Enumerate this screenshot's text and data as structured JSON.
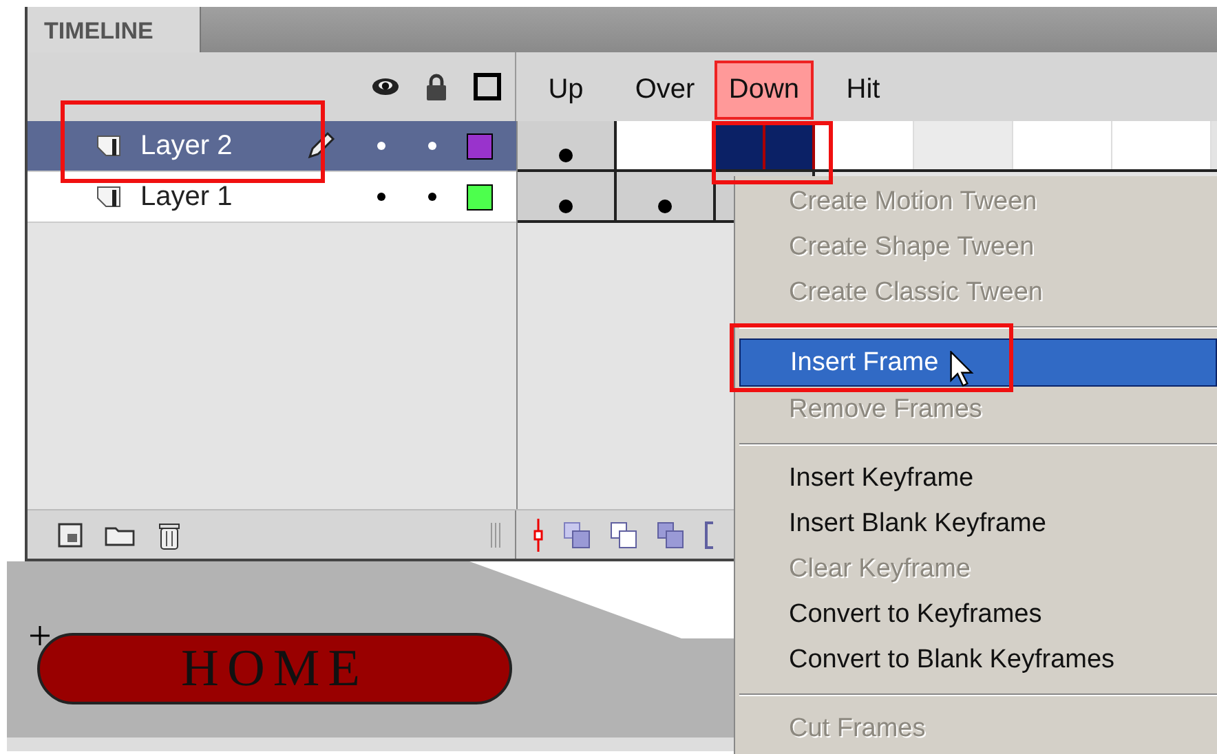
{
  "panel": {
    "tab": "TIMELINE"
  },
  "frame_labels": [
    {
      "label": "Up",
      "selected": false
    },
    {
      "label": "Over",
      "selected": false
    },
    {
      "label": "Down",
      "selected": true
    },
    {
      "label": "Hit",
      "selected": false
    }
  ],
  "layers": [
    {
      "name": "Layer 2",
      "selected": true,
      "editing": true,
      "color": "#9933cc",
      "frames": [
        {
          "kind": "keyframe"
        },
        {
          "kind": "empty"
        },
        {
          "kind": "selected"
        },
        {
          "kind": "selected"
        },
        {
          "kind": "empty"
        },
        {
          "kind": "shaded"
        },
        {
          "kind": "empty"
        },
        {
          "kind": "empty"
        }
      ]
    },
    {
      "name": "Layer 1",
      "selected": false,
      "editing": false,
      "color": "#4dff4d",
      "frames": [
        {
          "kind": "keyframe"
        },
        {
          "kind": "keyframe"
        },
        {
          "kind": "frame"
        }
      ]
    }
  ],
  "stage": {
    "button_label": "HOME"
  },
  "context_menu": [
    {
      "kind": "item",
      "label": "Create Motion Tween",
      "disabled": true,
      "selected": false
    },
    {
      "kind": "item",
      "label": "Create Shape Tween",
      "disabled": true,
      "selected": false
    },
    {
      "kind": "item",
      "label": "Create Classic Tween",
      "disabled": true,
      "selected": false
    },
    {
      "kind": "separator"
    },
    {
      "kind": "item",
      "label": "Insert Frame",
      "disabled": false,
      "selected": true
    },
    {
      "kind": "item",
      "label": "Remove Frames",
      "disabled": true,
      "selected": false
    },
    {
      "kind": "separator"
    },
    {
      "kind": "item",
      "label": "Insert Keyframe",
      "disabled": false,
      "selected": false
    },
    {
      "kind": "item",
      "label": "Insert Blank Keyframe",
      "disabled": false,
      "selected": false
    },
    {
      "kind": "item",
      "label": "Clear Keyframe",
      "disabled": true,
      "selected": false
    },
    {
      "kind": "item",
      "label": "Convert to Keyframes",
      "disabled": false,
      "selected": false
    },
    {
      "kind": "item",
      "label": "Convert to Blank Keyframes",
      "disabled": false,
      "selected": false
    },
    {
      "kind": "separator"
    },
    {
      "kind": "item",
      "label": "Cut Frames",
      "disabled": true,
      "selected": false
    }
  ]
}
